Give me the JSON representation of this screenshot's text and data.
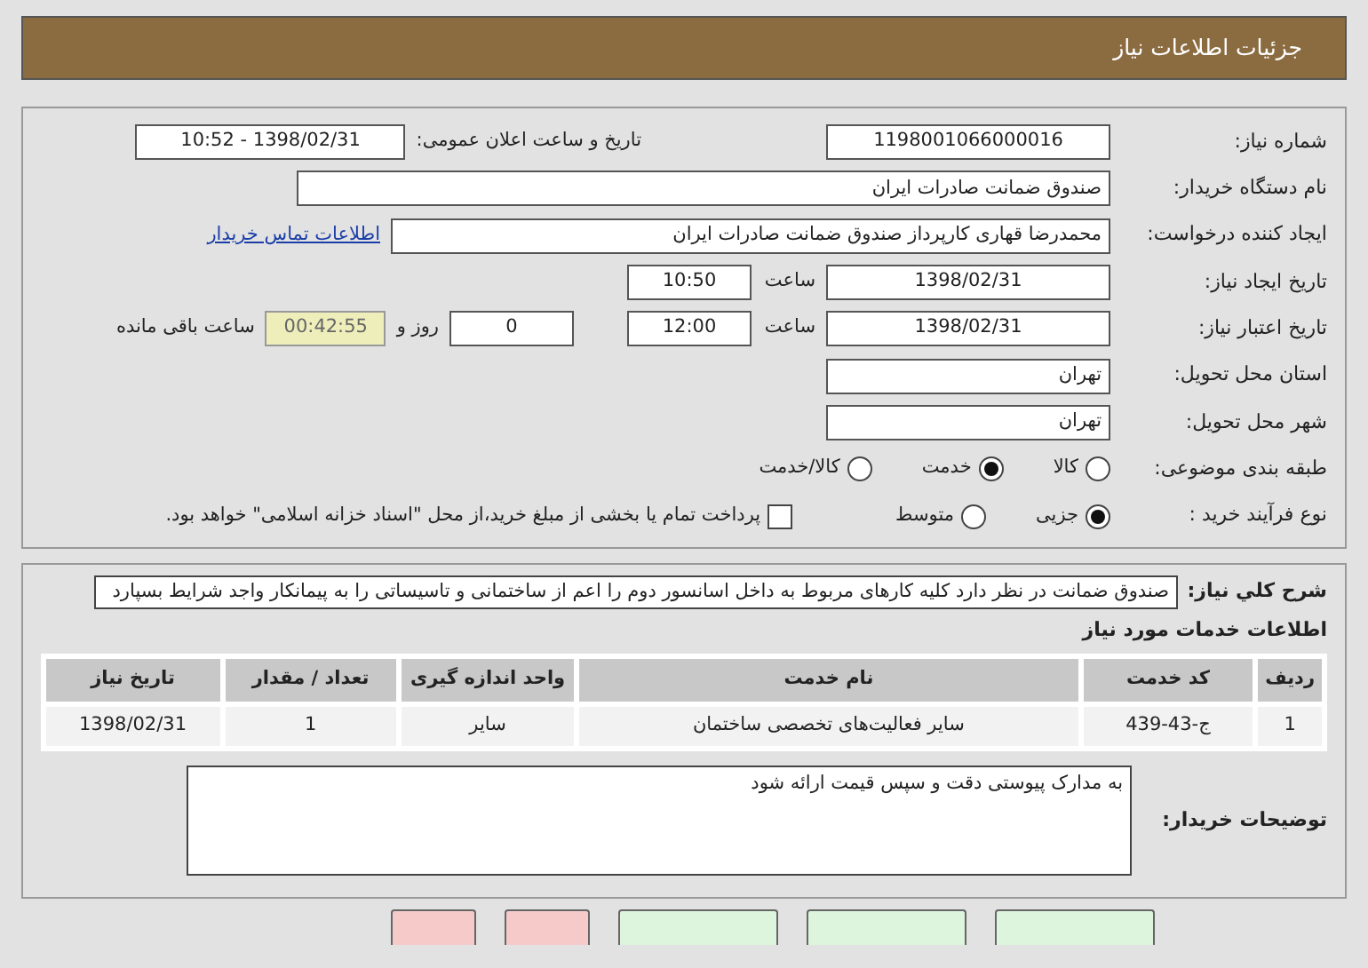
{
  "header": {
    "title": "جزئیات اطلاعات نیاز"
  },
  "fields": [
    {
      "kind": "pair",
      "label": "شماره نیاز:",
      "value": "1198001066000016",
      "label2": "تاریخ و ساعت اعلان عمومی:",
      "value2": "1398/02/31 - 10:52"
    },
    {
      "kind": "wide",
      "label": "نام دستگاه خریدار:",
      "value": "صندوق ضمانت صادرات ایران"
    },
    {
      "kind": "link",
      "label": "ایجاد کننده درخواست:",
      "value": "محمدرضا قهاری کارپرداز صندوق ضمانت صادرات ایران",
      "link": "اطلاعات تماس خریدار"
    },
    {
      "kind": "datetime",
      "label": "تاریخ ایجاد نیاز:",
      "value": "1398/02/31",
      "time_label": "ساعت",
      "time": "10:50"
    },
    {
      "kind": "deadline",
      "label": "تاریخ اعتبار نیاز:",
      "value": "1398/02/31",
      "time_label": "ساعت",
      "time": "12:00",
      "days": "0",
      "days_label": "روز و",
      "remaining": "00:42:55",
      "remaining_label": "ساعت باقی مانده"
    },
    {
      "kind": "short",
      "label": "استان محل تحویل:",
      "value": "تهران"
    },
    {
      "kind": "short",
      "label": "شهر محل تحویل:",
      "value": "تهران"
    }
  ],
  "category": {
    "label": "طبقه بندی موضوعی:",
    "options": [
      {
        "label": "کالا",
        "selected": false
      },
      {
        "label": "خدمت",
        "selected": true
      },
      {
        "label": "کالا/خدمت",
        "selected": false
      }
    ]
  },
  "process": {
    "label": "نوع فرآیند خرید :",
    "options": [
      {
        "label": "جزیی",
        "selected": true
      },
      {
        "label": "متوسط",
        "selected": false
      }
    ],
    "treasury": {
      "checked": false,
      "label": "پرداخت تمام یا بخشی از مبلغ خرید،از محل \"اسناد خزانه اسلامی\" خواهد بود."
    }
  },
  "description": {
    "label": "شرح کلي نیاز:",
    "text": "صندوق ضمانت در نظر دارد کلیه کارهای مربوط به داخل اسانسور دوم را اعم از ساختمانی و تاسیساتی را به پیمانکار واجد شرایط بسپارد"
  },
  "services": {
    "title": "اطلاعات خدمات مورد نیاز",
    "columns": [
      "ردیف",
      "کد خدمت",
      "نام خدمت",
      "واحد اندازه گیری",
      "تعداد / مقدار",
      "تاریخ نیاز"
    ],
    "rows": [
      [
        "1",
        "ج-43-439",
        "سایر فعالیت‌های تخصصی ساختمان",
        "سایر",
        "1",
        "1398/02/31"
      ]
    ]
  },
  "buyer_notes": {
    "label": "توضیحات خریدار:",
    "text": "به مدارک پیوستی دقت و سپس قیمت ارائه شود"
  },
  "bottom_buttons": [
    {
      "kind": "green"
    },
    {
      "kind": "green"
    },
    {
      "kind": "green"
    },
    {
      "kind": "red"
    },
    {
      "kind": "red"
    }
  ]
}
